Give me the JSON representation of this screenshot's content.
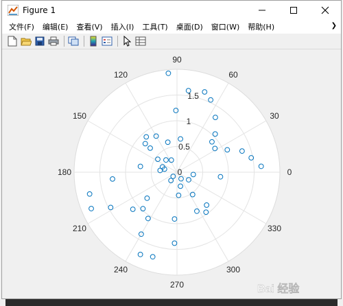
{
  "window": {
    "title": "Figure 1"
  },
  "menu": {
    "items": [
      "文件(F)",
      "编辑(E)",
      "查看(V)",
      "插入(I)",
      "工具(T)",
      "桌面(D)",
      "窗口(W)",
      "帮助(H)"
    ],
    "overflow_icon": "chevron-right-icon"
  },
  "toolbar": {
    "icons": [
      "new-figure-icon",
      "open-icon",
      "save-icon",
      "print-icon",
      "link-plot-icon",
      "colorbar-icon",
      "legend-icon",
      "pointer-icon",
      "property-editor-icon"
    ]
  },
  "chart_data": {
    "type": "scatter",
    "coordinate_system": "polar",
    "title": "",
    "theta_ticks": [
      "0",
      "30",
      "60",
      "90",
      "120",
      "150",
      "180",
      "210",
      "240",
      "270",
      "300",
      "330"
    ],
    "r_ticks": [
      "0",
      "0.5",
      "1",
      "1.5"
    ],
    "rlim": [
      0,
      2
    ],
    "grid": true,
    "marker": "circle",
    "marker_color": "#0072bd",
    "points": [
      {
        "theta": 82,
        "r": 1.6
      },
      {
        "theta": 71,
        "r": 1.65
      },
      {
        "theta": 65,
        "r": 1.55
      },
      {
        "theta": 91,
        "r": 1.2
      },
      {
        "theta": 55,
        "r": 1.3
      },
      {
        "theta": 45,
        "r": 1.05
      },
      {
        "theta": 41,
        "r": 0.9
      },
      {
        "theta": 32,
        "r": 0.87
      },
      {
        "theta": 24,
        "r": 1.07
      },
      {
        "theta": 18,
        "r": 1.33
      },
      {
        "theta": 11,
        "r": 1.47
      },
      {
        "theta": 4,
        "r": 1.64
      },
      {
        "theta": 354,
        "r": 0.85
      },
      {
        "theta": 84,
        "r": 0.65
      },
      {
        "theta": 107,
        "r": 0.61
      },
      {
        "theta": 120,
        "r": 0.81
      },
      {
        "theta": 131,
        "r": 0.91
      },
      {
        "theta": 138,
        "r": 0.7
      },
      {
        "theta": 138,
        "r": 0.83
      },
      {
        "theta": 115,
        "r": 0.26
      },
      {
        "theta": 132,
        "r": 0.32
      },
      {
        "theta": 146,
        "r": 0.45
      },
      {
        "theta": 160,
        "r": 0.3
      },
      {
        "theta": 171,
        "r": 0.72
      },
      {
        "theta": 174,
        "r": 0.33
      },
      {
        "theta": 166,
        "r": 0.25
      },
      {
        "theta": 186,
        "r": 1.26
      },
      {
        "theta": 194,
        "r": 1.75
      },
      {
        "theta": 203,
        "r": 1.81
      },
      {
        "theta": 208,
        "r": 1.46
      },
      {
        "theta": 220,
        "r": 1.12
      },
      {
        "theta": 227,
        "r": 0.97
      },
      {
        "theta": 221,
        "r": 0.77
      },
      {
        "theta": 238,
        "r": 1.06
      },
      {
        "theta": 240,
        "r": 1.39
      },
      {
        "theta": 246,
        "r": 1.75
      },
      {
        "theta": 254,
        "r": 1.71
      },
      {
        "theta": 268,
        "r": 1.38
      },
      {
        "theta": 267,
        "r": 0.91
      },
      {
        "theta": 274,
        "r": 0.45
      },
      {
        "theta": 284,
        "r": 0.28
      },
      {
        "theta": 302,
        "r": 0.15
      },
      {
        "theta": 327,
        "r": 0.27
      },
      {
        "theta": 352,
        "r": 0.32
      },
      {
        "theta": 305,
        "r": 0.53
      },
      {
        "theta": 297,
        "r": 0.85
      },
      {
        "theta": 306,
        "r": 0.96
      },
      {
        "theta": 312,
        "r": 0.86
      },
      {
        "theta": 234,
        "r": 0.2
      },
      {
        "theta": 227,
        "r": 0.11
      },
      {
        "theta": 95,
        "r": 1.93
      }
    ]
  },
  "watermark": {
    "text": "Bai 经验"
  }
}
